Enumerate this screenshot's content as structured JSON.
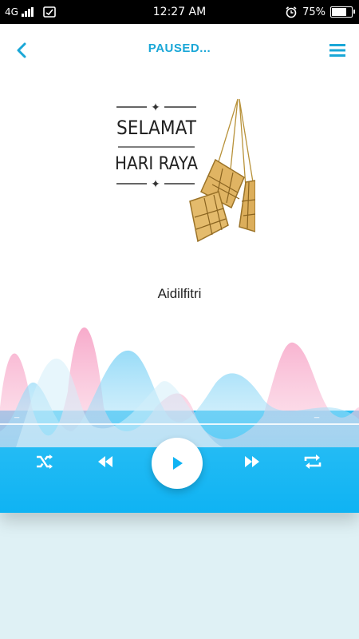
{
  "status_bar": {
    "network": "4G",
    "time": "12:27 AM",
    "battery_percent": "75%",
    "battery_level": 0.75
  },
  "header": {
    "title": "PAUSED...",
    "back_icon": "chevron-left-icon",
    "menu_icon": "hamburger-menu-icon"
  },
  "cover": {
    "line1": "SELAMAT",
    "line2": "HARI RAYA"
  },
  "track": {
    "name": "Aidilfitri",
    "elapsed": "_",
    "duration": "_"
  },
  "controls": {
    "shuffle_icon": "shuffle-icon",
    "previous_icon": "rewind-icon",
    "play_icon": "play-icon",
    "next_icon": "fast-forward-icon",
    "repeat_icon": "repeat-icon"
  },
  "colors": {
    "accent": "#1aa7d7",
    "panel": "#0fb3f3",
    "wave_pink": "#f7a6c8",
    "wave_blue": "#5bcaf5",
    "background": "#dff1f5"
  }
}
